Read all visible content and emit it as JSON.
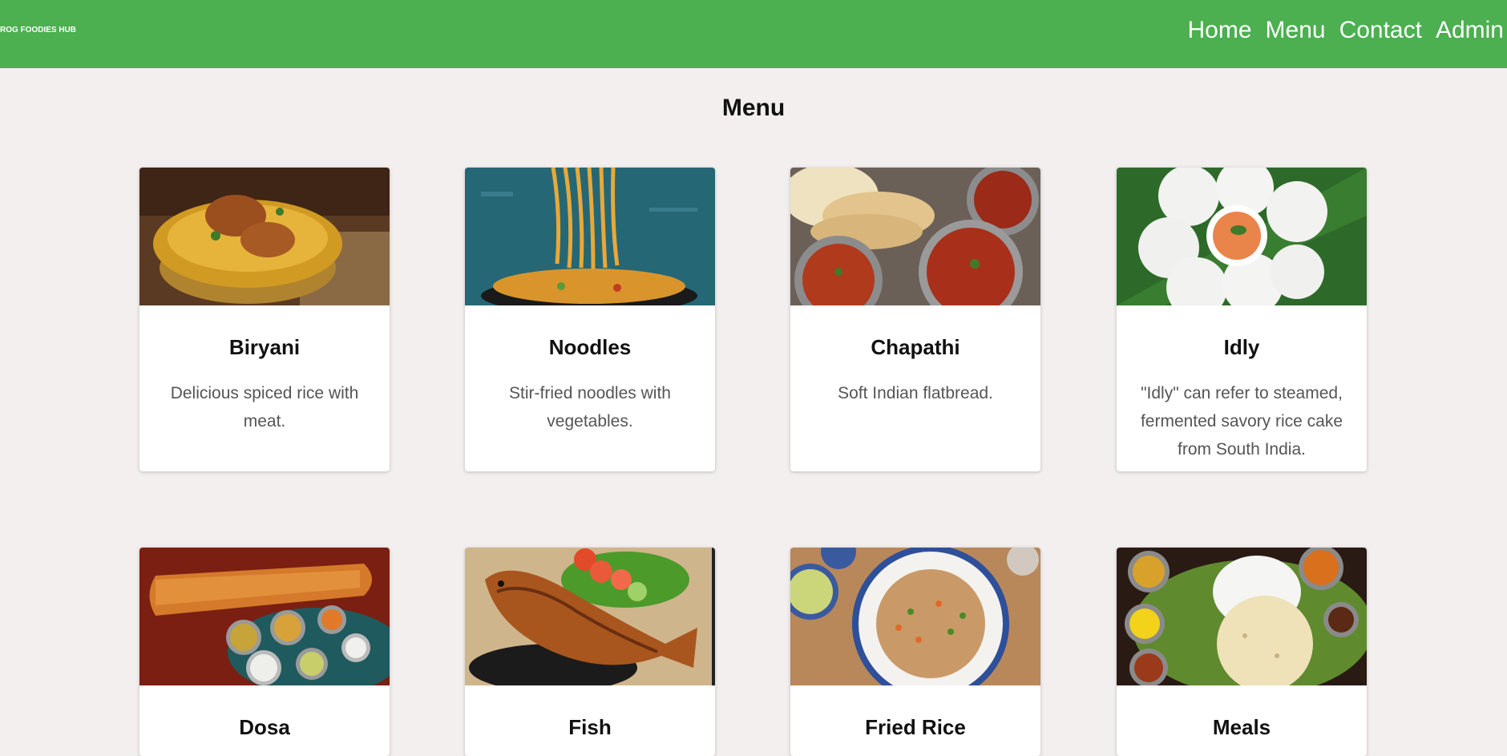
{
  "header": {
    "brand": "ROG FOODIES HUB",
    "nav": [
      "Home",
      "Menu",
      "Contact",
      "Admin"
    ]
  },
  "page_title": "Menu",
  "items": [
    {
      "name": "Biryani",
      "description": "Delicious spiced rice with meat."
    },
    {
      "name": "Noodles",
      "description": "Stir-fried noodles with vegetables."
    },
    {
      "name": "Chapathi",
      "description": "Soft Indian flatbread."
    },
    {
      "name": "Idly",
      "description": "\"Idly\" can refer to steamed, fermented savory rice cake from South India."
    },
    {
      "name": "Dosa",
      "description": ""
    },
    {
      "name": "Fish",
      "description": ""
    },
    {
      "name": "Fried Rice",
      "description": ""
    },
    {
      "name": "Meals",
      "description": ""
    }
  ],
  "colors": {
    "header_bg": "#4caf50",
    "page_bg": "#f3efee",
    "card_bg": "#ffffff"
  }
}
